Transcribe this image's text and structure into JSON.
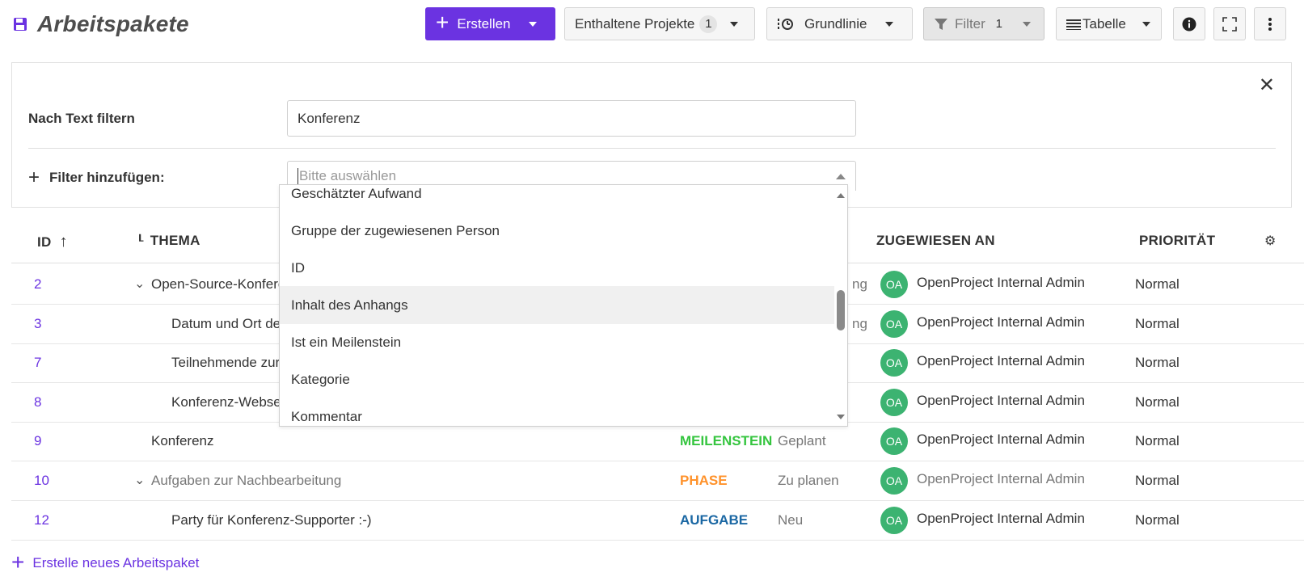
{
  "page_title": "Arbeitspakete",
  "toolbar": {
    "create_label": "Erstellen",
    "projects_label": "Enthaltene Projekte",
    "projects_count": "1",
    "baseline_label": "Grundlinie",
    "filter_label": "Filter",
    "filter_count": "1",
    "table_label": "Tabelle"
  },
  "filter_panel": {
    "text_filter_label": "Nach Text filtern",
    "text_filter_value": "Konferenz",
    "add_filter_label": "Filter hinzufügen:",
    "select_placeholder": "Bitte auswählen",
    "options": [
      "Geschätzter Aufwand",
      "Gruppe der zugewiesenen Person",
      "ID",
      "Inhalt des Anhangs",
      "Ist ein Meilenstein",
      "Kategorie",
      "Kommentar"
    ],
    "highlighted_option_index": 3
  },
  "table": {
    "headers": {
      "id": "ID",
      "thema": "THEMA",
      "assigned": "ZUGEWIESEN AN",
      "priority": "PRIORITÄT"
    },
    "rows": [
      {
        "id": "2",
        "thema": "Open-Source-Konferenz",
        "expandable": true,
        "indent": 0,
        "type": "",
        "status": "",
        "status_tail": "ng",
        "avatar": "OA",
        "assignee": "OpenProject Internal Admin",
        "priority": "Normal"
      },
      {
        "id": "3",
        "thema": "Datum und Ort der Konferenz",
        "expandable": false,
        "indent": 1,
        "type": "",
        "status": "",
        "status_tail": "ng",
        "avatar": "OA",
        "assignee": "OpenProject Internal Admin",
        "priority": "Normal"
      },
      {
        "id": "7",
        "thema": "Teilnehmende zur Konferenz",
        "expandable": false,
        "indent": 1,
        "type": "",
        "status": "",
        "status_tail": "",
        "avatar": "OA",
        "assignee": "OpenProject Internal Admin",
        "priority": "Normal"
      },
      {
        "id": "8",
        "thema": "Konferenz-Webseite",
        "expandable": false,
        "indent": 1,
        "type": "",
        "status": "",
        "status_tail": "",
        "avatar": "OA",
        "assignee": "OpenProject Internal Admin",
        "priority": "Normal"
      },
      {
        "id": "9",
        "thema": "Konferenz",
        "expandable": false,
        "indent": 0,
        "type": "MEILENSTEIN",
        "type_color": "#35c53f",
        "status": "Geplant",
        "status_tail": "",
        "avatar": "OA",
        "assignee": "OpenProject Internal Admin",
        "priority": "Normal"
      },
      {
        "id": "10",
        "thema": "Aufgaben zur Nachbearbeitung",
        "expandable": true,
        "indent": 0,
        "muted": true,
        "type": "PHASE",
        "type_color": "#ff922b",
        "status": "Zu planen",
        "status_tail": "",
        "avatar": "OA",
        "assignee": "OpenProject Internal Admin",
        "priority": "Normal"
      },
      {
        "id": "12",
        "thema": "Party für Konferenz-Supporter :-)",
        "expandable": false,
        "indent": 1,
        "type": "AUFGABE",
        "type_color": "#1a67a3",
        "status": "Neu",
        "status_tail": "",
        "avatar": "OA",
        "assignee": "OpenProject Internal Admin",
        "priority": "Normal"
      }
    ]
  },
  "create_link": "Erstelle neues Arbeitspaket",
  "colors": {
    "accent": "#6b33e1",
    "avatar": "#3cb371"
  },
  "icons": [
    "save-icon",
    "plus-icon",
    "chevron-down-icon",
    "baseline-icon",
    "filter-icon",
    "table-icon",
    "info-icon",
    "fullscreen-icon",
    "more-vertical-icon",
    "close-icon",
    "sort-arrow-icon",
    "hierarchy-icon",
    "gear-icon"
  ]
}
